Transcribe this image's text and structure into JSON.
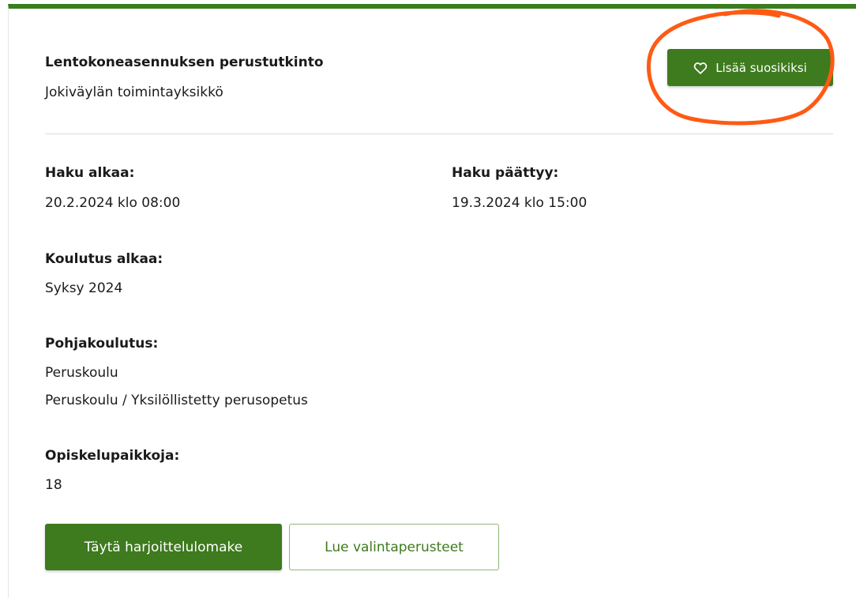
{
  "program": {
    "title": "Lentokoneasennuksen perustutkinto",
    "unit": "Jokiväylän toimintayksikkö"
  },
  "favorite_button": {
    "label": "Lisää suosikiksi",
    "icon": "heart-outline-icon"
  },
  "application_start": {
    "label": "Haku alkaa:",
    "value": "20.2.2024 klo 08:00"
  },
  "application_end": {
    "label": "Haku päättyy:",
    "value": "19.3.2024 klo 15:00"
  },
  "training_start": {
    "label": "Koulutus alkaa:",
    "value": "Syksy 2024"
  },
  "base_education": {
    "label": "Pohjakoulutus:",
    "items": [
      "Peruskoulu",
      "Peruskoulu / Yksilöllistetty perusopetus"
    ]
  },
  "study_places": {
    "label": "Opiskelupaikkoja:",
    "value": "18"
  },
  "actions": {
    "primary_label": "Täytä harjoittelulomake",
    "secondary_label": "Lue valintaperusteet"
  },
  "colors": {
    "brand_green": "#3e7a1e",
    "annotation_orange": "#ff5a14"
  }
}
